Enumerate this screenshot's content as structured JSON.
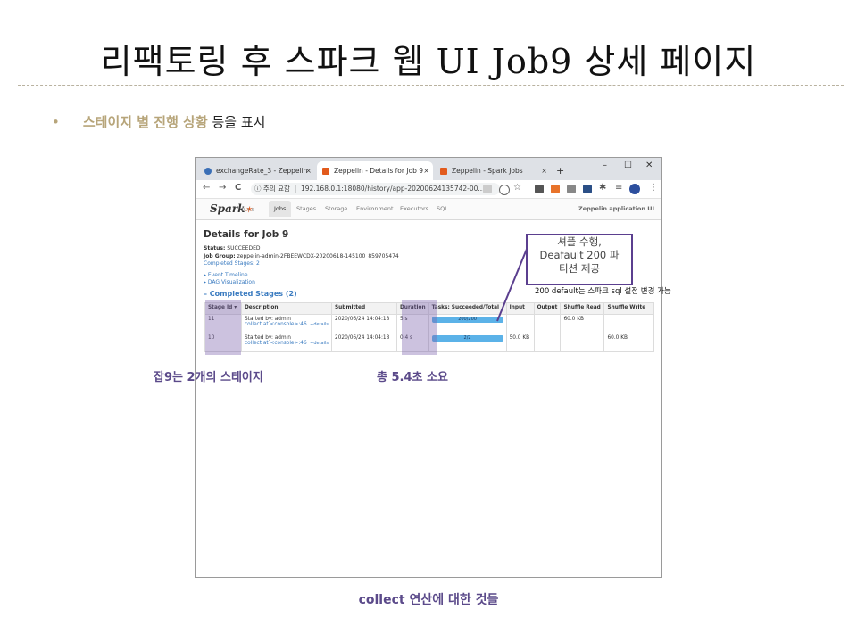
{
  "slide": {
    "title": "리팩토링 후 스파크 웹 UI Job9 상세 페이지",
    "bullet_marker": "•",
    "bullet_strong": "스테이지 별 진행 상황",
    "bullet_rest": " 등을 표시",
    "footer_note": "collect 연산에 대한 것들"
  },
  "browser": {
    "tabs": [
      {
        "label": "exchangeRate_3 - Zeppelin",
        "close": "×"
      },
      {
        "label": "Zeppelin - Details for Job 9",
        "close": "×"
      },
      {
        "label": "Zeppelin - Spark Jobs",
        "close": "×"
      }
    ],
    "new_tab": "+",
    "window_controls": {
      "minimize": "–",
      "maximize": "☐",
      "close": "✕"
    },
    "nav": {
      "back": "←",
      "forward": "→",
      "reload": "C"
    },
    "url_prefix": "ⓘ 주의 요함",
    "url": "192.168.0.1:18080/history/app-20200624135742-00..."
  },
  "spark": {
    "logo": "Spark",
    "version": "2.4.5",
    "tabs": [
      "Jobs",
      "Stages",
      "Storage",
      "Environment",
      "Executors",
      "SQL"
    ],
    "active_tab": "Jobs",
    "app_name": "Zeppelin application UI",
    "page_title": "Details for Job 9",
    "status_label": "Status:",
    "status_value": "SUCCEEDED",
    "job_group_label": "Job Group:",
    "job_group_value": "zeppelin-admin-2FBEEWCDX-20200618-145100_859705474",
    "completed_stages_link": "Completed Stages: 2",
    "event_timeline": "▸ Event Timeline",
    "dag_visualization": "▸ DAG Visualization",
    "section_title": "– Completed Stages (2)",
    "table": {
      "headers": [
        "Stage Id ▾",
        "Description",
        "Submitted",
        "Duration",
        "Tasks: Succeeded/Total",
        "Input",
        "Output",
        "Shuffle Read",
        "Shuffle Write"
      ],
      "rows": [
        {
          "stage_id": "11",
          "desc_line1": "Started by: admin",
          "desc_link": "collect at <console>:46",
          "details": "+details",
          "submitted": "2020/06/24 14:04:18",
          "duration": "5 s",
          "tasks": "200/200",
          "tasks_fraction": 1.0,
          "input": "",
          "output": "",
          "shuffle_read": "60.0 KB",
          "shuffle_write": ""
        },
        {
          "stage_id": "10",
          "desc_line1": "Started by: admin",
          "desc_link": "collect at <console>:46",
          "details": "+details",
          "submitted": "2020/06/24 14:04:18",
          "duration": "0.4 s",
          "tasks": "2/2",
          "tasks_fraction": 1.0,
          "input": "50.0 KB",
          "output": "",
          "shuffle_read": "",
          "shuffle_write": "60.0 KB"
        }
      ]
    }
  },
  "annotations": {
    "callout_lines": [
      "셔플 수행,",
      "Deafault 200 파",
      "티션 제공"
    ],
    "callout_note": "200 default는 스파크 sql 설정 변경 가능",
    "stages_label": "잡9는 2개의 스테이지",
    "duration_label": "총 5.4초 소요",
    "highlight_color": "#785eaa",
    "accent_color": "#b7a57a"
  }
}
